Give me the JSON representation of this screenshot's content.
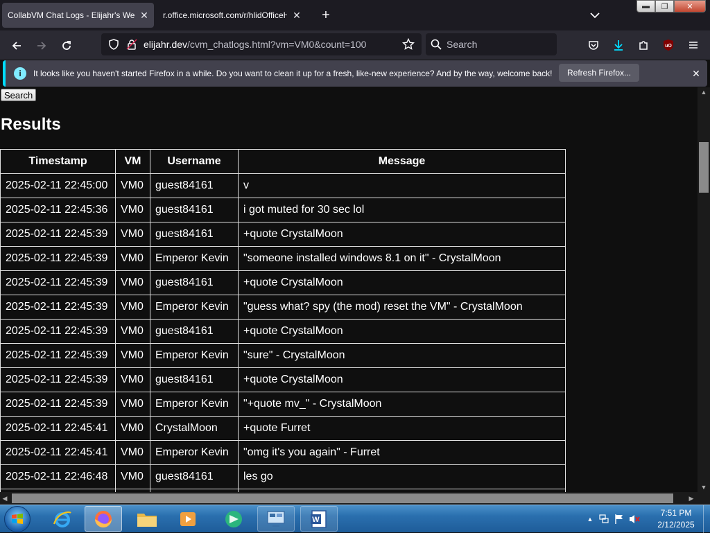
{
  "browser": {
    "tabs": [
      {
        "label": "CollabVM Chat Logs - Elijahr's Web",
        "active": true
      },
      {
        "label": "r.office.microsoft.com/r/hlidOfficeH",
        "active": false
      }
    ],
    "url": {
      "host": "elijahr.dev",
      "path": "/cvm_chatlogs.html?vm=VM0&count=100"
    },
    "search_placeholder": "Search",
    "toolbar_icons": [
      "pocket-icon",
      "download-icon",
      "extensions-icon",
      "ublock-icon",
      "menu-icon"
    ]
  },
  "notification": {
    "message": "It looks like you haven't started Firefox in a while. Do you want to clean it up for a fresh, like-new experience? And by the way, welcome back!",
    "button_label": "Refresh Firefox..."
  },
  "page": {
    "search_button": "Search",
    "results_heading": "Results",
    "table": {
      "headers": [
        "Timestamp",
        "VM",
        "Username",
        "Message"
      ],
      "rows": [
        [
          "2025-02-11 22:45:00",
          "VM0",
          "guest84161",
          "v"
        ],
        [
          "2025-02-11 22:45:36",
          "VM0",
          "guest84161",
          "i got muted for 30 sec lol"
        ],
        [
          "2025-02-11 22:45:39",
          "VM0",
          "guest84161",
          "+quote CrystalMoon"
        ],
        [
          "2025-02-11 22:45:39",
          "VM0",
          "Emperor Kevin",
          "\"someone installed windows 8.1 on it\" - CrystalMoon"
        ],
        [
          "2025-02-11 22:45:39",
          "VM0",
          "guest84161",
          "+quote CrystalMoon"
        ],
        [
          "2025-02-11 22:45:39",
          "VM0",
          "Emperor Kevin",
          "\"guess what? spy (the mod) reset the VM\" - CrystalMoon"
        ],
        [
          "2025-02-11 22:45:39",
          "VM0",
          "guest84161",
          "+quote CrystalMoon"
        ],
        [
          "2025-02-11 22:45:39",
          "VM0",
          "Emperor Kevin",
          "\"sure\" - CrystalMoon"
        ],
        [
          "2025-02-11 22:45:39",
          "VM0",
          "guest84161",
          "+quote CrystalMoon"
        ],
        [
          "2025-02-11 22:45:39",
          "VM0",
          "Emperor Kevin",
          "\"+quote mv_\" - CrystalMoon"
        ],
        [
          "2025-02-11 22:45:41",
          "VM0",
          "CrystalMoon",
          "+quote Furret"
        ],
        [
          "2025-02-11 22:45:41",
          "VM0",
          "Emperor Kevin",
          "\"omg it's you again\" - Furret"
        ],
        [
          "2025-02-11 22:46:48",
          "VM0",
          "guest84161",
          "les go"
        ],
        [
          "",
          "",
          "",
          ""
        ]
      ]
    }
  },
  "taskbar": {
    "apps": [
      "internet-explorer",
      "firefox",
      "file-explorer",
      "media-player",
      "collabvm-app",
      "remote-desktop",
      "microsoft-word"
    ],
    "time": "7:51 PM",
    "date": "2/12/2025"
  },
  "colors": {
    "accent": "#00ddff",
    "tab_active": "#42414d",
    "toolbar": "#2b2a33",
    "page_bg": "#0f0f0f"
  }
}
